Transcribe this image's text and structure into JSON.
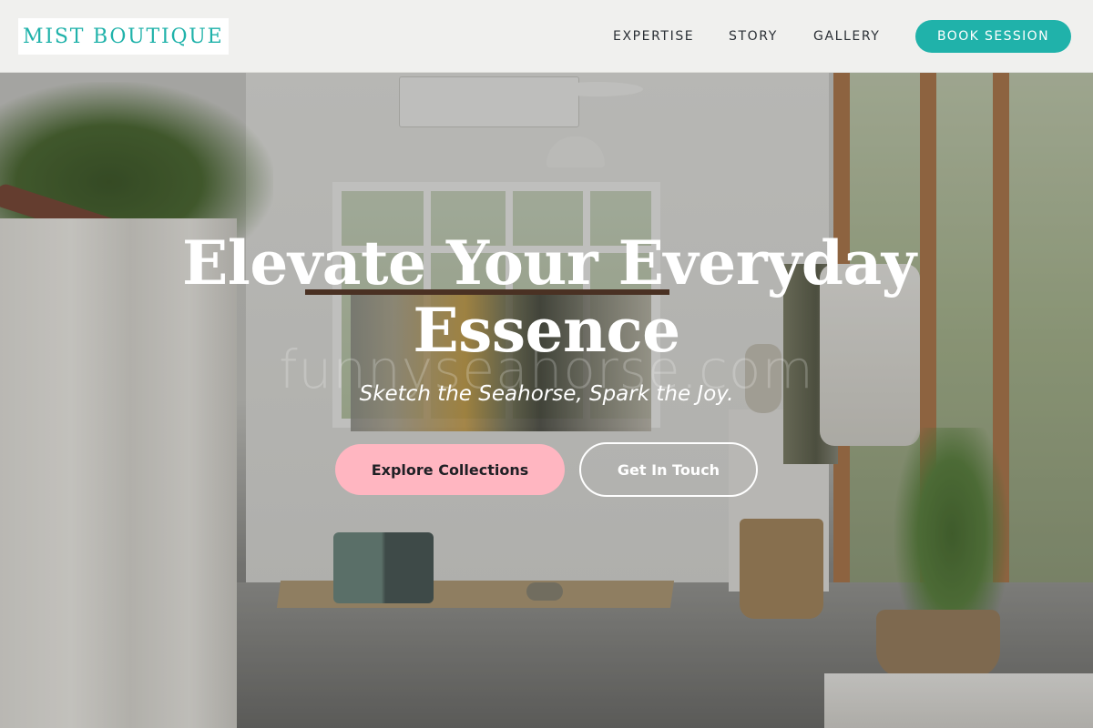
{
  "brand": {
    "name": "MIST BOUTIQUE",
    "accent_color": "#20b2aa",
    "pink_color": "#ffb6c1"
  },
  "nav": {
    "items": [
      {
        "label": "EXPERTISE"
      },
      {
        "label": "STORY"
      },
      {
        "label": "GALLERY"
      }
    ],
    "cta_label": "BOOK SESSION"
  },
  "hero": {
    "title_line1": "Elevate Your Everyday",
    "title_line2": "Essence",
    "tagline": "Sketch the Seahorse, Spark the Joy.",
    "primary_button": "Explore Collections",
    "secondary_button": "Get In Touch",
    "watermark": "funnyseahorse.com",
    "background_image": "boutique-interior-photo"
  }
}
